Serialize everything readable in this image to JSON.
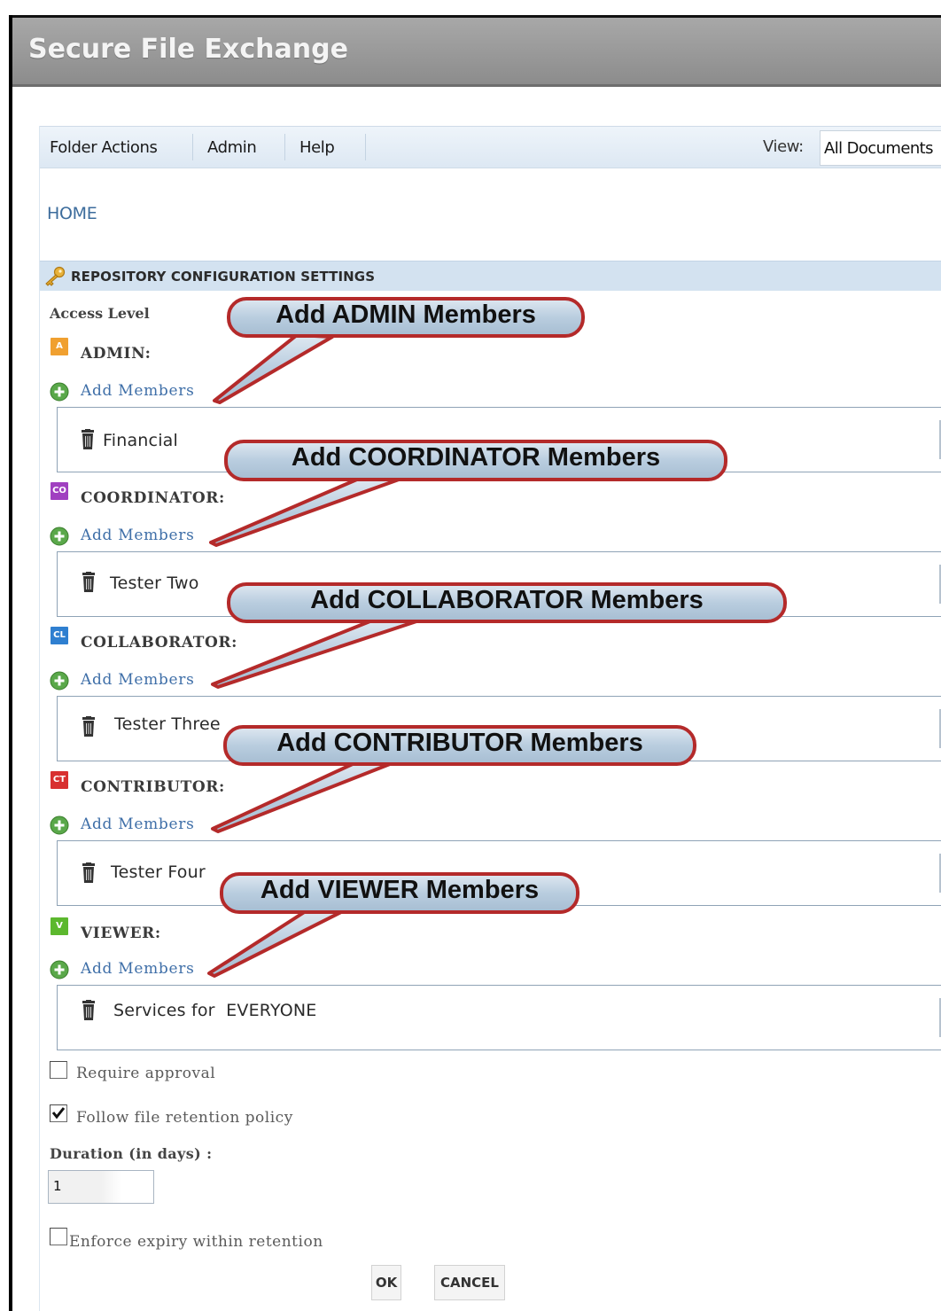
{
  "app": {
    "title": "Secure File Exchange"
  },
  "menu": {
    "items": [
      "Folder Actions",
      "Admin",
      "Help"
    ],
    "view_label": "View:",
    "view_value": "All Documents"
  },
  "breadcrumb": {
    "home": "HOME"
  },
  "section": {
    "title": "REPOSITORY CONFIGURATION SETTINGS",
    "access_level": "Access Level"
  },
  "roles": [
    {
      "badge": "A",
      "badge_color": "#f0a030",
      "label": "ADMIN:",
      "add_label": "Add Members",
      "member": "Financial",
      "callout": "Add ADMIN Members"
    },
    {
      "badge": "CO",
      "badge_color": "#a040c0",
      "label": "COORDINATOR:",
      "add_label": "Add Members",
      "member": "Tester Two",
      "callout": "Add COORDINATOR Members"
    },
    {
      "badge": "CL",
      "badge_color": "#2f7fd0",
      "label": "COLLABORATOR:",
      "add_label": "Add Members",
      "member": "Tester Three",
      "callout": "Add COLLABORATOR Members"
    },
    {
      "badge": "CT",
      "badge_color": "#d83030",
      "label": "CONTRIBUTOR:",
      "add_label": "Add Members",
      "member": "Tester Four",
      "callout": "Add CONTRIBUTOR Members"
    },
    {
      "badge": "V",
      "badge_color": "#5cb82e",
      "label": "VIEWER:",
      "add_label": "Add Members",
      "member": "Services for  EVERYONE",
      "callout": "Add VIEWER Members"
    }
  ],
  "options": {
    "require_approval": {
      "label": "Require approval",
      "checked": false
    },
    "follow_retention": {
      "label": "Follow file retention policy",
      "checked": true
    },
    "duration_label": "Duration (in days) :",
    "duration_value": "1",
    "enforce_expiry": {
      "label": "Enforce expiry within retention",
      "checked": false
    }
  },
  "buttons": {
    "ok": "OK",
    "cancel": "CANCEL"
  },
  "colors": {
    "link": "#3f6fa8",
    "callout_fill": "#b7cadb",
    "callout_border": "#b42a2a",
    "header": "#999999"
  },
  "icons": {
    "add": "plus-circle-icon",
    "delete": "trash-icon",
    "section": "key-icon"
  }
}
